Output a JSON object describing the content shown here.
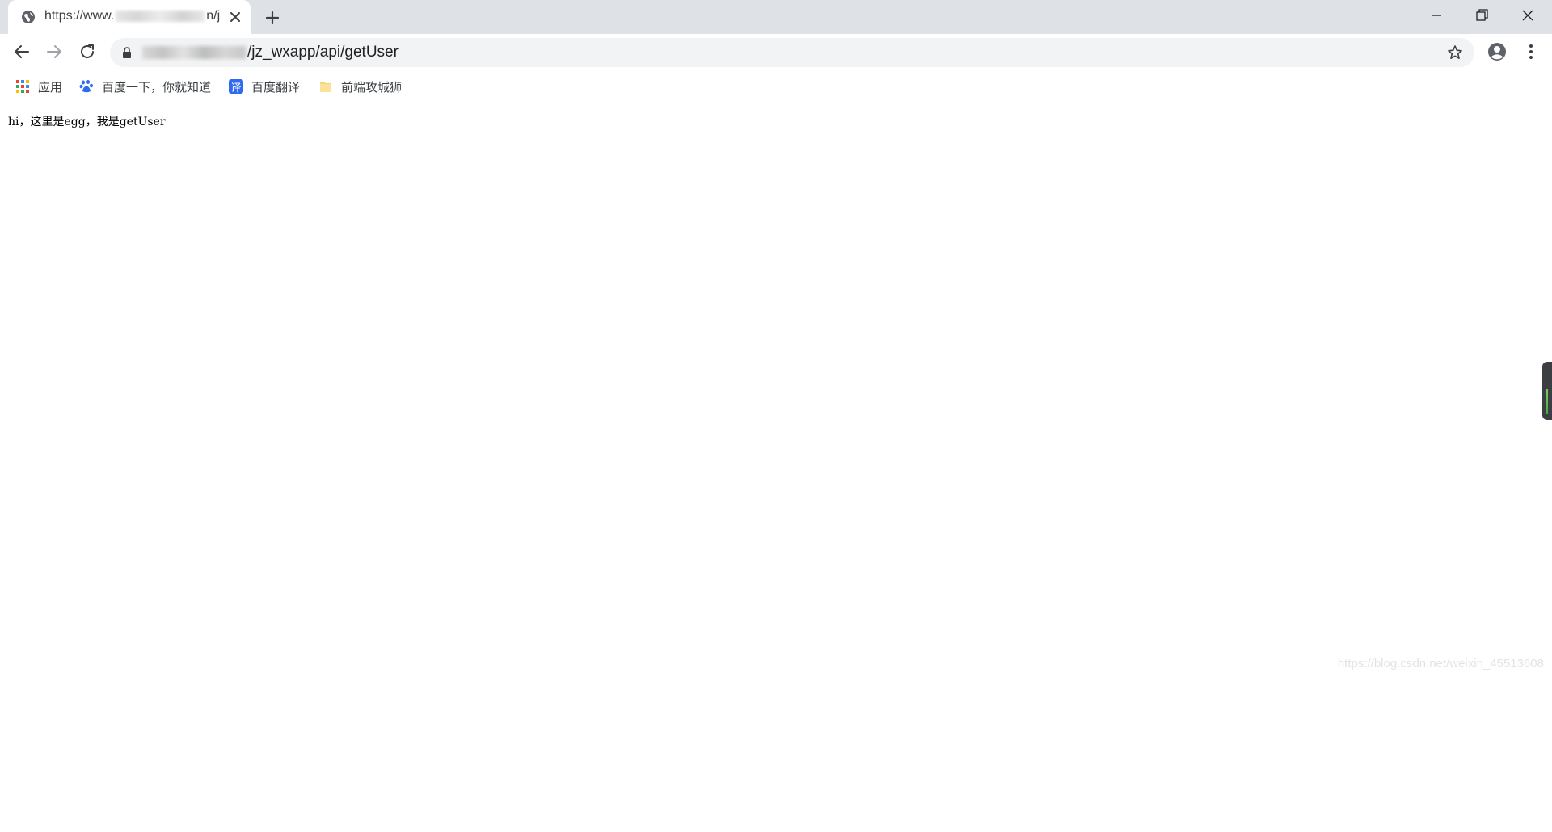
{
  "tab": {
    "title_prefix": "https://www.",
    "title_suffix": "n/j",
    "favicon": "globe-icon",
    "close_icon": "close-icon"
  },
  "window_controls": [
    "minimize-icon",
    "restore-icon",
    "close-icon"
  ],
  "toolbar": {
    "back_icon": "back-arrow-icon",
    "forward_icon": "forward-arrow-icon",
    "reload_icon": "reload-icon",
    "url_visible": "/jz_wxapp/api/getUser",
    "lock_icon": "lock-icon",
    "bookmark_icon": "star-icon",
    "profile_icon": "account-icon",
    "menu_icon": "more-vertical-icon"
  },
  "bookmarks": [
    {
      "label": "应用",
      "icon": "apps-grid-icon"
    },
    {
      "label": "百度一下，你就知道",
      "icon": "baidu-paw-icon"
    },
    {
      "label": "百度翻译",
      "icon": "translate-icon",
      "icon_text": "译"
    },
    {
      "label": "前端攻城狮",
      "icon": "folder-icon"
    }
  ],
  "page": {
    "text": "hi，这里是egg，我是getUser"
  },
  "watermark": "https://blog.csdn.net/weixin_45513608",
  "colors": {
    "tabstrip": "#dee1e6",
    "omnibox": "#f1f3f4",
    "baidu_blue": "#2f6bf0",
    "folder_yellow": "#f6d575"
  }
}
